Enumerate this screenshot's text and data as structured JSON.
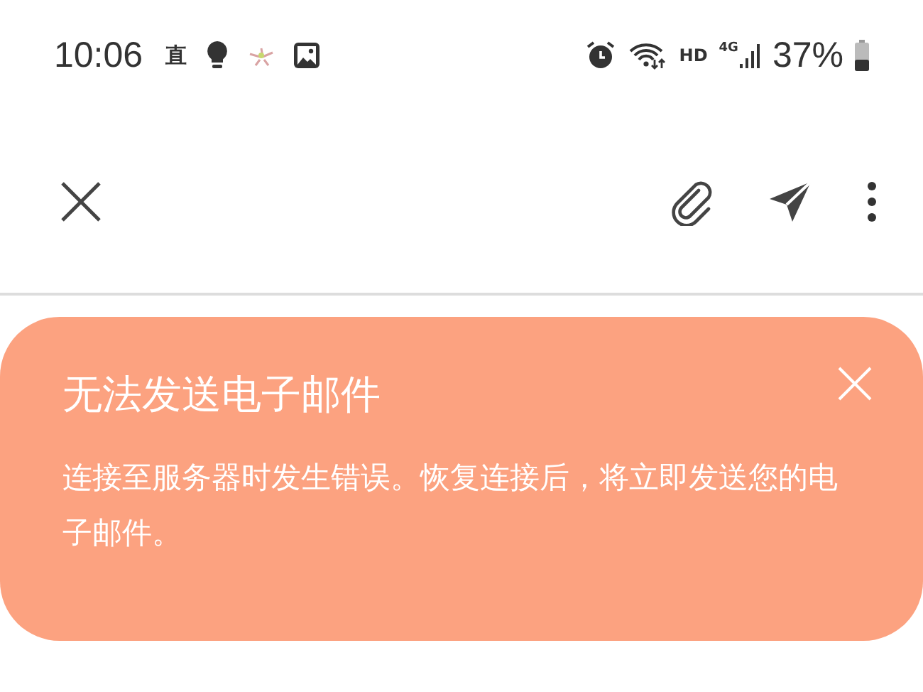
{
  "status_bar": {
    "time": "10:06",
    "app_glyph": "直",
    "network_label": "HD",
    "signal_label": "4G",
    "battery": "37%"
  },
  "error_banner": {
    "title": "无法发送电子邮件",
    "message": "连接至服务器时发生错误。恢复连接后，将立即发送您的电子邮件。"
  }
}
